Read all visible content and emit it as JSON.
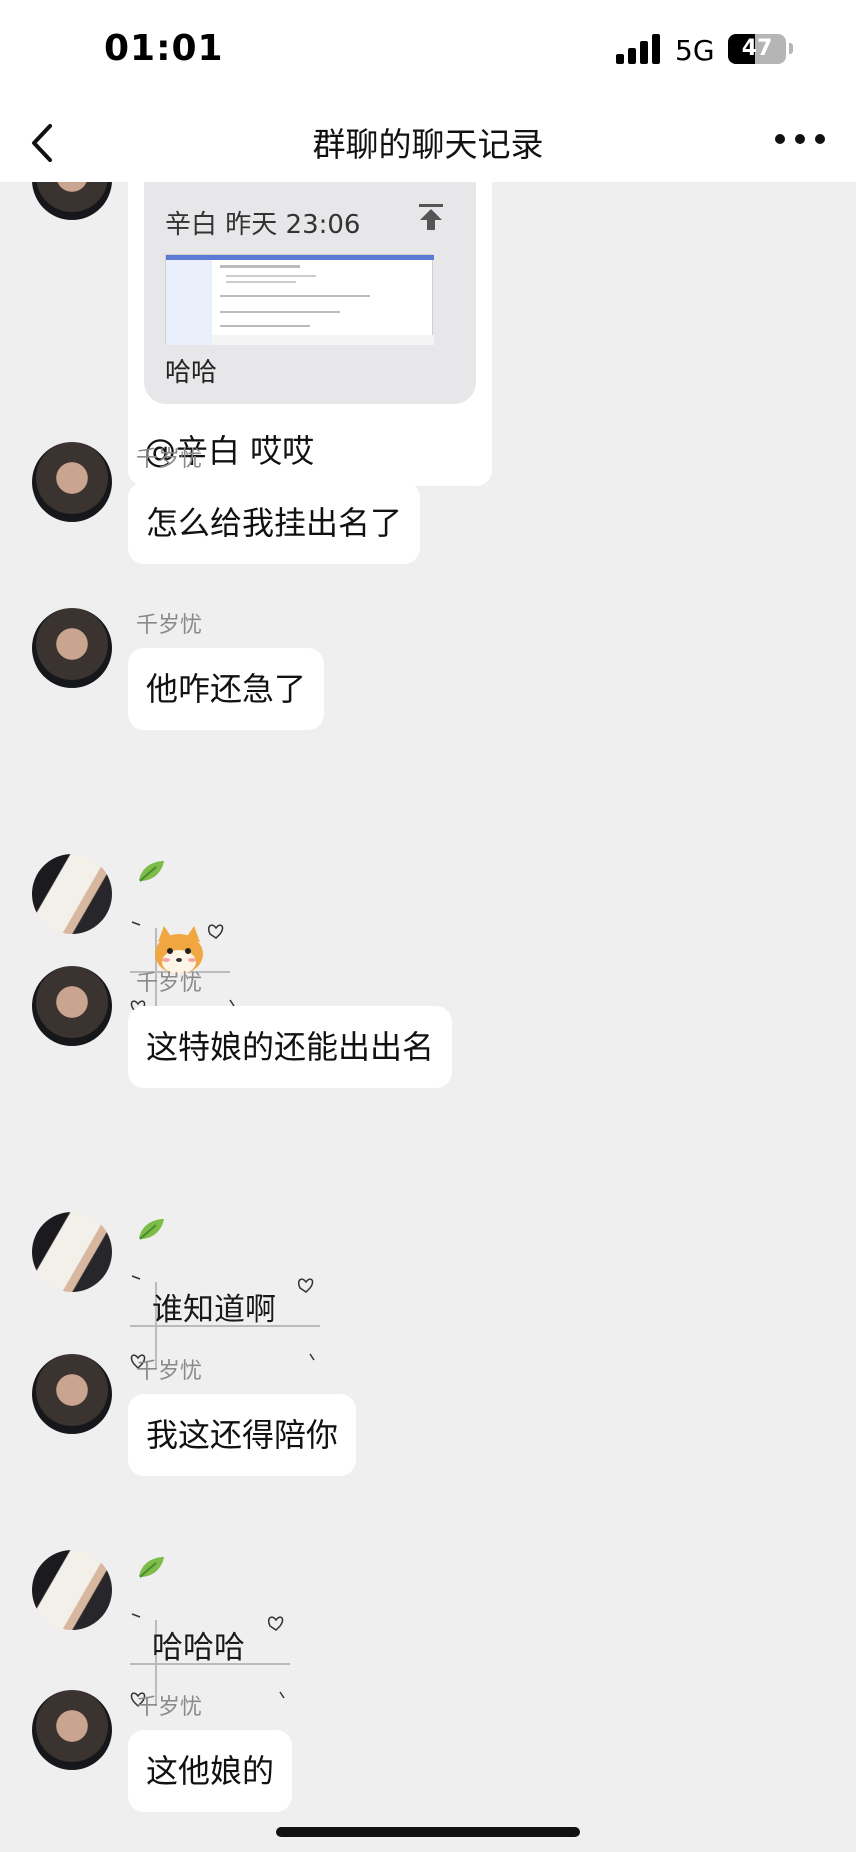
{
  "status_bar": {
    "time": "01:01",
    "network": "5G",
    "battery": "47",
    "battery_level": 0.47
  },
  "nav": {
    "title": "群聊的聊天记录",
    "back_icon": "chevron-left-icon",
    "more_icon": "ellipsis-icon"
  },
  "quote": {
    "header": "辛白 昨天 23:06",
    "text": "哈哈",
    "mention": "@辛白 哎哎",
    "icon": "pin-top-icon"
  },
  "messages": [
    {
      "sender": "千岁忧",
      "text": "怎么给我挂出名了"
    },
    {
      "sender": "千岁忧",
      "text": "他咋还急了"
    },
    {
      "sender": "",
      "text": "",
      "sticker": "shiba-dog-emoji"
    },
    {
      "sender": "千岁忧",
      "text": "这特娘的还能出出名"
    },
    {
      "sender": "",
      "text": "谁知道啊"
    },
    {
      "sender": "千岁忧",
      "text": "我这还得陪你"
    },
    {
      "sender": "",
      "text": "哈哈哈"
    },
    {
      "sender": "千岁忧",
      "text": "这他娘的"
    }
  ],
  "colors": {
    "background": "#efefef",
    "bubble": "#ffffff",
    "quote_card": "#e7e7e9",
    "sender_name": "#8a8a8a",
    "leaf": "#7cbd4a"
  }
}
